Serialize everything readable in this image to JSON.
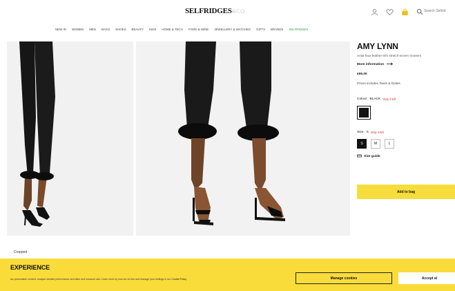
{
  "header": {
    "logo": "SELFRIDGES",
    "logo_sub": "&CO",
    "search_label": "Search Selfrid"
  },
  "nav": [
    "NEW IN",
    "WOMEN",
    "MEN",
    "BAGS",
    "SHOES",
    "BEAUTY",
    "KIDS",
    "HOME & TECH",
    "FOOD & WINE",
    "JEWELLERY & WATCHES",
    "GIFTS",
    "BRANDS",
    "SELFRIDGES"
  ],
  "product": {
    "brand": "AMY LYNN",
    "subtitle": "Anita faux feather-trim stretch-woven trousers",
    "more_info": "More information",
    "price": "£95.00",
    "taxes": "Prices includes Taxes & Duties",
    "colour_label": "Colour:",
    "colour_value": "BLACK",
    "colour_stock": "Only 4 left",
    "size_label": "Size:",
    "size_value": "S",
    "size_stock": "Only 4 left",
    "sizes": [
      "S",
      "M",
      "L"
    ],
    "size_guide": "Size guide",
    "add_to_bag": "Add to bag"
  },
  "gallery": {
    "caption": "Cropped"
  },
  "cookie": {
    "title": "EXPERIENCE",
    "text": "ise personalise content, analyse website performance and tailor and measure ads. Learn more by how we do this and manage your settings in our",
    "link": "Cookie Policy",
    "manage": "Manage cookies",
    "accept": "Accept al"
  },
  "colors": {
    "yellow": "#f9dc3a",
    "stock_red": "#d0252f",
    "nav_green": "#2e9a3a"
  }
}
